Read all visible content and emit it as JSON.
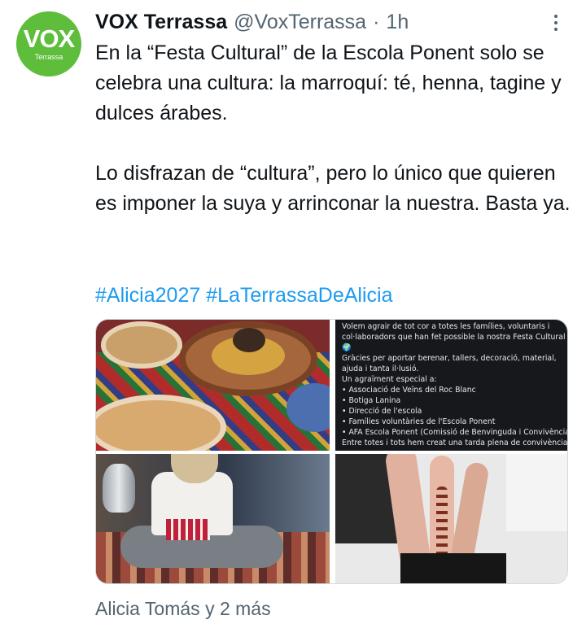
{
  "account": {
    "display_name": "VOX Terrassa",
    "handle": "@VoxTerrassa",
    "separator": "·",
    "time": "1h",
    "avatar_text": "VOX",
    "avatar_subtext": "Terrassa",
    "avatar_color": "#5ebd3a"
  },
  "tweet": {
    "paragraph1": "En la “Festa Cultural” de la Escola Ponent solo se celebra una cultura: la marroquí: té, henna, tagine y dulces árabes.",
    "paragraph2": "Lo disfrazan de “cultura”, pero lo único que quieren es imponer la suya y arrinconar la nuestra. Basta ya.",
    "hashtags": [
      "#Alicia2027",
      "#LaTerrassaDeAlicia"
    ],
    "hashtag_color": "#1d9bf0"
  },
  "media": {
    "notice_lines": [
      "Volem agrair de tot cor a totes les famílies, voluntaris i",
      "col·laboradors que han fet possible la nostra Festa Cultural",
      "🌍",
      "Gràcies per aportar berenar, tallers, decoració, material,",
      "ajuda i tanta il·lusió.",
      "Un agraïment especial a:",
      "• Associació de Veïns del Roc Blanc",
      "• Botiga Lanina",
      "• Direcció de l'escola",
      "• Famílies voluntàries de l'Escola Ponent",
      "• AFA Escola Ponent (Comissió de Benvinguda i Convivència)",
      "Entre totes i tots hem creat una tarda plena de convivència,"
    ]
  },
  "footer": {
    "replies_text": "Alicia Tomás y 2 más"
  },
  "icons": {
    "more": "more-icon"
  }
}
